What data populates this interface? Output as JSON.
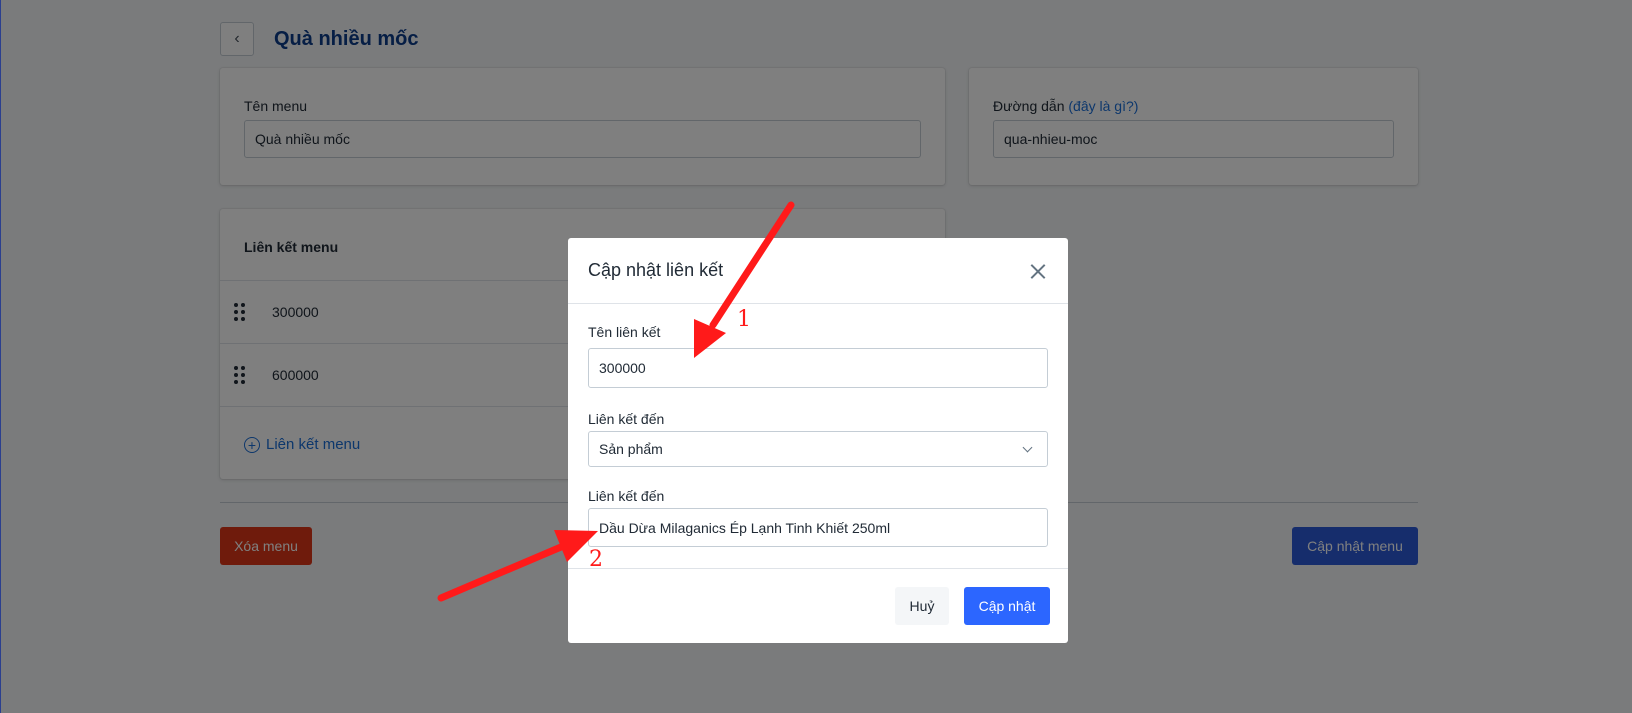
{
  "header": {
    "title": "Quà nhiều mốc"
  },
  "menu_name": {
    "label": "Tên menu",
    "value": "Quà nhiều mốc"
  },
  "slug": {
    "label": "Đường dẫn",
    "help": "(đây là gì?)",
    "value": "qua-nhieu-moc"
  },
  "links_card": {
    "title": "Liên kết menu",
    "items": [
      {
        "label": "300000"
      },
      {
        "label": "600000"
      }
    ],
    "add_label": "Liên kết menu"
  },
  "actions": {
    "delete_label": "Xóa menu",
    "update_label": "Cập nhật menu"
  },
  "modal": {
    "title": "Cập nhật liên kết",
    "name_label": "Tên liên kết",
    "name_value": "300000",
    "type_label": "Liên kết đến",
    "type_value": "Sản phẩm",
    "target_label": "Liên kết đến",
    "target_value": "Dầu Dừa Milaganics Ép Lạnh Tinh Khiết 250ml",
    "cancel_label": "Huỷ",
    "confirm_label": "Cập nhật"
  },
  "annotations": {
    "color": "#ff1a1a",
    "marker_1": "1",
    "marker_2": "2"
  },
  "colors": {
    "accent": "#2c66ff",
    "title": "#0d3c8a",
    "danger": "#de3618",
    "link": "#1a6ed8"
  }
}
